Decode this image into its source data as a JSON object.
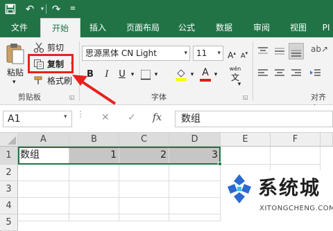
{
  "title_bar": {
    "icons": [
      "save-icon",
      "undo-icon",
      "redo-icon",
      "customize-quick-access-icon"
    ]
  },
  "tabs": [
    {
      "label": "文件",
      "active": false
    },
    {
      "label": "开始",
      "active": true
    },
    {
      "label": "插入",
      "active": false
    },
    {
      "label": "页面布局",
      "active": false
    },
    {
      "label": "公式",
      "active": false
    },
    {
      "label": "数据",
      "active": false
    },
    {
      "label": "审阅",
      "active": false
    },
    {
      "label": "视图",
      "active": false
    },
    {
      "label": "PI",
      "active": false
    }
  ],
  "ribbon": {
    "clipboard": {
      "paste_label": "粘贴",
      "cut_label": "剪切",
      "copy_label": "复制",
      "format_painter_label": "格式刷",
      "group_label": "剪贴板"
    },
    "font": {
      "font_name": "思源黑体 CN Light",
      "font_size": "11",
      "bold": "B",
      "italic": "I",
      "underline": "U",
      "font_color": "A",
      "phonetic": "wén",
      "group_label": "字体"
    },
    "alignment": {
      "group_label": "对齐方"
    }
  },
  "formula_bar": {
    "name_box": "A1",
    "cancel_glyph": "✕",
    "enter_glyph": "✓",
    "fx_label": "fx",
    "value": "数组"
  },
  "grid": {
    "columns": [
      "A",
      "B",
      "C",
      "D",
      "E",
      "F"
    ],
    "rows": [
      "1",
      "2",
      "3",
      "4",
      "5"
    ],
    "row1": [
      "数组",
      "1",
      "2",
      "3"
    ]
  },
  "watermark": {
    "brand": "系统城",
    "url": "XITONGCHENG.COM"
  },
  "colors": {
    "excel_green": "#217346",
    "callout_red": "#e8211d",
    "selection_gray": "#c6c6c6"
  }
}
